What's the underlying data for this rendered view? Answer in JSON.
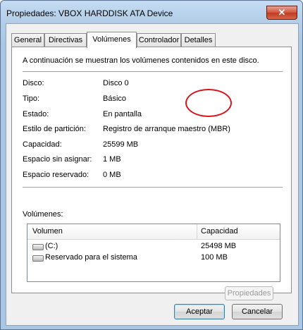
{
  "window": {
    "title": "Propiedades: VBOX HARDDISK ATA Device",
    "close_glyph": "✕"
  },
  "tabs": [
    {
      "label": "General"
    },
    {
      "label": "Directivas"
    },
    {
      "label": "Volúmenes"
    },
    {
      "label": "Controlador"
    },
    {
      "label": "Detalles"
    }
  ],
  "active_tab": "Volúmenes",
  "panel": {
    "intro": "A continuación se muestran los volúmenes contenidos en este disco.",
    "disk_info": [
      {
        "label": "Disco:",
        "value": "Disco 0"
      },
      {
        "label": "Tipo:",
        "value": "Básico"
      },
      {
        "label": "Estado:",
        "value": "En pantalla"
      },
      {
        "label": "Estilo de partición:",
        "value": "Registro de arranque maestro (MBR)"
      },
      {
        "label": "Capacidad:",
        "value": "25599 MB"
      },
      {
        "label": "Espacio sin asignar:",
        "value": "1 MB"
      },
      {
        "label": "Espacio reservado:",
        "value": "0 MB"
      }
    ],
    "volumes_label": "Volúmenes:",
    "volumes_table": {
      "columns": [
        "Volumen",
        "Capacidad"
      ],
      "rows": [
        {
          "name": "(C:)",
          "capacity": "25498 MB",
          "icon": "drive-icon"
        },
        {
          "name": "Reservado para el sistema",
          "capacity": "100 MB",
          "icon": "drive-icon"
        }
      ]
    },
    "properties_button": "Propiedades"
  },
  "buttons": {
    "ok": "Aceptar",
    "cancel": "Cancelar"
  },
  "annotation": {
    "color": "#d9151c",
    "shape": "ellipse"
  }
}
